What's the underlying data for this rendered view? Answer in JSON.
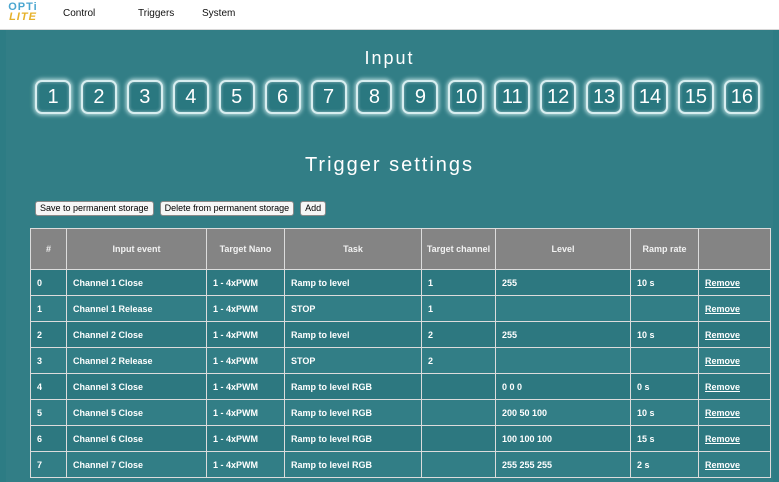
{
  "logo": {
    "line1": "OPTi",
    "line2": "LITE"
  },
  "nav": [
    "Control",
    "Triggers",
    "System"
  ],
  "input_title": "Input",
  "inputs": [
    "1",
    "2",
    "3",
    "4",
    "5",
    "6",
    "7",
    "8",
    "9",
    "10",
    "11",
    "12",
    "13",
    "14",
    "15",
    "16"
  ],
  "trigger_title": "Trigger settings",
  "actions": {
    "save": "Save to permanent storage",
    "delete": "Delete from permanent storage",
    "add": "Add"
  },
  "table": {
    "headers": [
      "#",
      "Input event",
      "Target Nano",
      "Task",
      "Target channel",
      "Level",
      "Ramp rate",
      ""
    ],
    "rows": [
      {
        "num": "0",
        "event": "Channel 1 Close",
        "nano": "1 - 4xPWM",
        "task": "Ramp to level",
        "channel": "1",
        "level": "255",
        "ramp": "10 s",
        "action": "Remove"
      },
      {
        "num": "1",
        "event": "Channel 1 Release",
        "nano": "1 - 4xPWM",
        "task": "STOP",
        "channel": "1",
        "level": "",
        "ramp": "",
        "action": "Remove"
      },
      {
        "num": "2",
        "event": "Channel 2 Close",
        "nano": "1 - 4xPWM",
        "task": "Ramp to level",
        "channel": "2",
        "level": "255",
        "ramp": "10 s",
        "action": "Remove"
      },
      {
        "num": "3",
        "event": "Channel 2 Release",
        "nano": "1 - 4xPWM",
        "task": "STOP",
        "channel": "2",
        "level": "",
        "ramp": "",
        "action": "Remove"
      },
      {
        "num": "4",
        "event": "Channel 3 Close",
        "nano": "1 - 4xPWM",
        "task": "Ramp to level RGB",
        "channel": "",
        "level": "0 0 0",
        "ramp": "0 s",
        "action": "Remove"
      },
      {
        "num": "5",
        "event": "Channel 5 Close",
        "nano": "1 - 4xPWM",
        "task": "Ramp to level RGB",
        "channel": "",
        "level": "200 50 100",
        "ramp": "10 s",
        "action": "Remove"
      },
      {
        "num": "6",
        "event": "Channel 6 Close",
        "nano": "1 - 4xPWM",
        "task": "Ramp to level RGB",
        "channel": "",
        "level": "100 100 100",
        "ramp": "15 s",
        "action": "Remove"
      },
      {
        "num": "7",
        "event": "Channel 7 Close",
        "nano": "1 - 4xPWM",
        "task": "Ramp to level RGB",
        "channel": "",
        "level": "255 255 255",
        "ramp": "2 s",
        "action": "Remove"
      }
    ]
  }
}
